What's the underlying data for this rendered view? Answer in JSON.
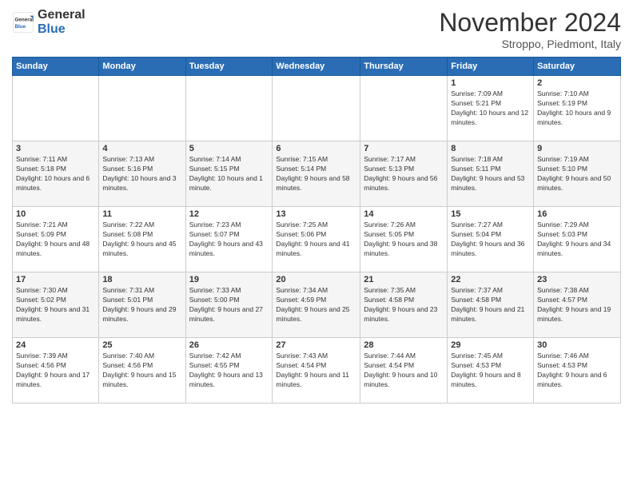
{
  "logo": {
    "general": "General",
    "blue": "Blue"
  },
  "title": "November 2024",
  "location": "Stroppo, Piedmont, Italy",
  "headers": [
    "Sunday",
    "Monday",
    "Tuesday",
    "Wednesday",
    "Thursday",
    "Friday",
    "Saturday"
  ],
  "weeks": [
    [
      {
        "day": "",
        "info": ""
      },
      {
        "day": "",
        "info": ""
      },
      {
        "day": "",
        "info": ""
      },
      {
        "day": "",
        "info": ""
      },
      {
        "day": "",
        "info": ""
      },
      {
        "day": "1",
        "info": "Sunrise: 7:09 AM\nSunset: 5:21 PM\nDaylight: 10 hours and 12 minutes."
      },
      {
        "day": "2",
        "info": "Sunrise: 7:10 AM\nSunset: 5:19 PM\nDaylight: 10 hours and 9 minutes."
      }
    ],
    [
      {
        "day": "3",
        "info": "Sunrise: 7:11 AM\nSunset: 5:18 PM\nDaylight: 10 hours and 6 minutes."
      },
      {
        "day": "4",
        "info": "Sunrise: 7:13 AM\nSunset: 5:16 PM\nDaylight: 10 hours and 3 minutes."
      },
      {
        "day": "5",
        "info": "Sunrise: 7:14 AM\nSunset: 5:15 PM\nDaylight: 10 hours and 1 minute."
      },
      {
        "day": "6",
        "info": "Sunrise: 7:15 AM\nSunset: 5:14 PM\nDaylight: 9 hours and 58 minutes."
      },
      {
        "day": "7",
        "info": "Sunrise: 7:17 AM\nSunset: 5:13 PM\nDaylight: 9 hours and 56 minutes."
      },
      {
        "day": "8",
        "info": "Sunrise: 7:18 AM\nSunset: 5:11 PM\nDaylight: 9 hours and 53 minutes."
      },
      {
        "day": "9",
        "info": "Sunrise: 7:19 AM\nSunset: 5:10 PM\nDaylight: 9 hours and 50 minutes."
      }
    ],
    [
      {
        "day": "10",
        "info": "Sunrise: 7:21 AM\nSunset: 5:09 PM\nDaylight: 9 hours and 48 minutes."
      },
      {
        "day": "11",
        "info": "Sunrise: 7:22 AM\nSunset: 5:08 PM\nDaylight: 9 hours and 45 minutes."
      },
      {
        "day": "12",
        "info": "Sunrise: 7:23 AM\nSunset: 5:07 PM\nDaylight: 9 hours and 43 minutes."
      },
      {
        "day": "13",
        "info": "Sunrise: 7:25 AM\nSunset: 5:06 PM\nDaylight: 9 hours and 41 minutes."
      },
      {
        "day": "14",
        "info": "Sunrise: 7:26 AM\nSunset: 5:05 PM\nDaylight: 9 hours and 38 minutes."
      },
      {
        "day": "15",
        "info": "Sunrise: 7:27 AM\nSunset: 5:04 PM\nDaylight: 9 hours and 36 minutes."
      },
      {
        "day": "16",
        "info": "Sunrise: 7:29 AM\nSunset: 5:03 PM\nDaylight: 9 hours and 34 minutes."
      }
    ],
    [
      {
        "day": "17",
        "info": "Sunrise: 7:30 AM\nSunset: 5:02 PM\nDaylight: 9 hours and 31 minutes."
      },
      {
        "day": "18",
        "info": "Sunrise: 7:31 AM\nSunset: 5:01 PM\nDaylight: 9 hours and 29 minutes."
      },
      {
        "day": "19",
        "info": "Sunrise: 7:33 AM\nSunset: 5:00 PM\nDaylight: 9 hours and 27 minutes."
      },
      {
        "day": "20",
        "info": "Sunrise: 7:34 AM\nSunset: 4:59 PM\nDaylight: 9 hours and 25 minutes."
      },
      {
        "day": "21",
        "info": "Sunrise: 7:35 AM\nSunset: 4:58 PM\nDaylight: 9 hours and 23 minutes."
      },
      {
        "day": "22",
        "info": "Sunrise: 7:37 AM\nSunset: 4:58 PM\nDaylight: 9 hours and 21 minutes."
      },
      {
        "day": "23",
        "info": "Sunrise: 7:38 AM\nSunset: 4:57 PM\nDaylight: 9 hours and 19 minutes."
      }
    ],
    [
      {
        "day": "24",
        "info": "Sunrise: 7:39 AM\nSunset: 4:56 PM\nDaylight: 9 hours and 17 minutes."
      },
      {
        "day": "25",
        "info": "Sunrise: 7:40 AM\nSunset: 4:56 PM\nDaylight: 9 hours and 15 minutes."
      },
      {
        "day": "26",
        "info": "Sunrise: 7:42 AM\nSunset: 4:55 PM\nDaylight: 9 hours and 13 minutes."
      },
      {
        "day": "27",
        "info": "Sunrise: 7:43 AM\nSunset: 4:54 PM\nDaylight: 9 hours and 11 minutes."
      },
      {
        "day": "28",
        "info": "Sunrise: 7:44 AM\nSunset: 4:54 PM\nDaylight: 9 hours and 10 minutes."
      },
      {
        "day": "29",
        "info": "Sunrise: 7:45 AM\nSunset: 4:53 PM\nDaylight: 9 hours and 8 minutes."
      },
      {
        "day": "30",
        "info": "Sunrise: 7:46 AM\nSunset: 4:53 PM\nDaylight: 9 hours and 6 minutes."
      }
    ]
  ]
}
